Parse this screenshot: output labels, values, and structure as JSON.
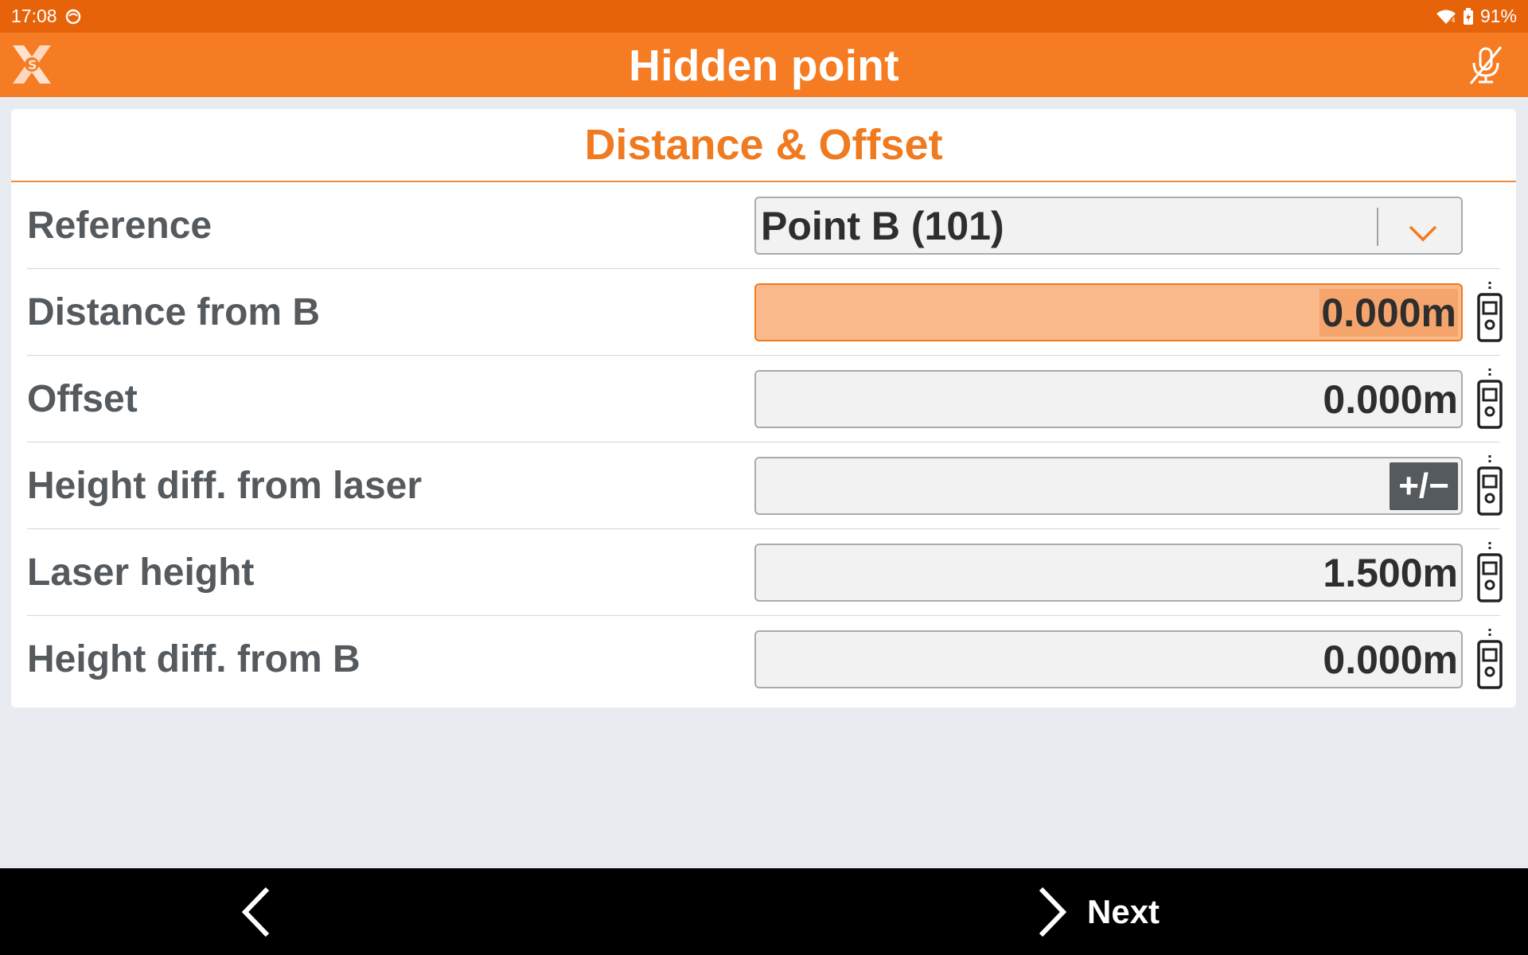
{
  "status_bar": {
    "time": "17:08",
    "battery_percent": "91%",
    "icons": [
      "notification-circle-icon",
      "wifi-icon",
      "battery-charging-icon"
    ]
  },
  "app_bar": {
    "title": "Hidden point",
    "logo": "x-s-logo",
    "mic_icon": "microphone-muted-icon"
  },
  "card": {
    "title": "Distance & Offset",
    "rows": [
      {
        "label": "Reference",
        "value": "Point B (101)",
        "type": "dropdown"
      },
      {
        "label": "Distance from B",
        "value": "0.000m",
        "type": "input",
        "active": true
      },
      {
        "label": "Offset",
        "value": "0.000m",
        "type": "input"
      },
      {
        "label": "Height diff. from laser",
        "value": "",
        "type": "input",
        "button": "+/−"
      },
      {
        "label": "Laser height",
        "value": "1.500m",
        "type": "input"
      },
      {
        "label": "Height diff. from B",
        "value": "0.000m",
        "type": "input"
      }
    ]
  },
  "bottom_bar": {
    "next_label": "Next"
  },
  "colors": {
    "status_bar": "#e6630a",
    "app_bar": "#f57c22",
    "accent": "#f07a20",
    "active_field": "#fab98a",
    "background": "#e8ebef"
  }
}
